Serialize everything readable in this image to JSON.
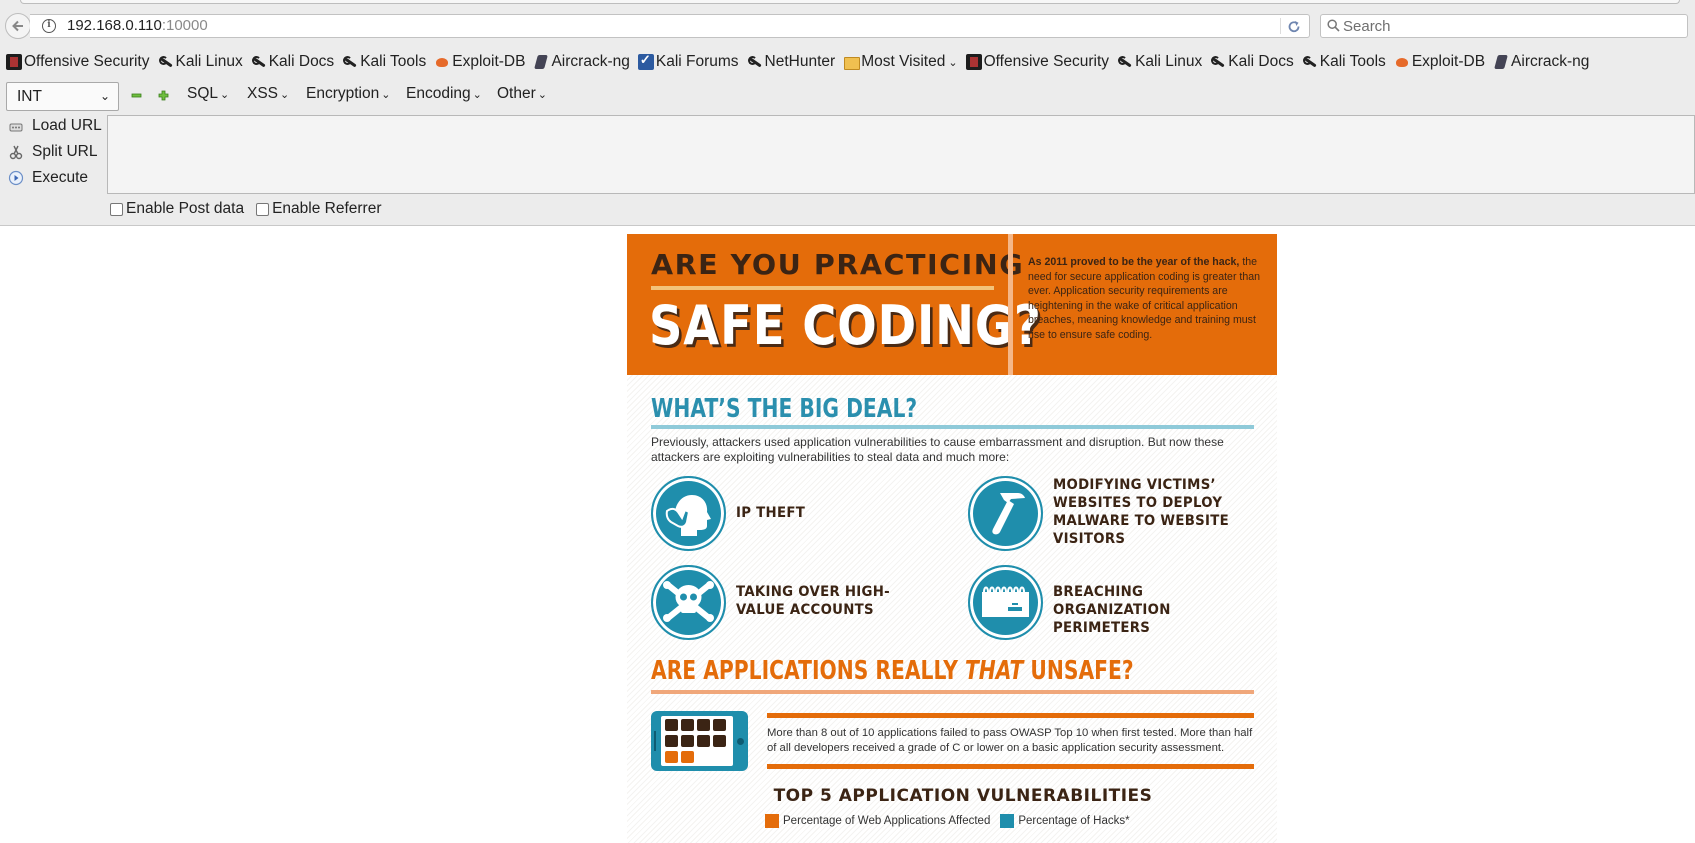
{
  "browser": {
    "url_host": "192.168.0.110",
    "url_port": ":10000",
    "search_placeholder": "Search",
    "bookmarks": [
      {
        "label": "Offensive Security",
        "icon": "offsec-icon"
      },
      {
        "label": "Kali Linux",
        "icon": "kali-icon"
      },
      {
        "label": "Kali Docs",
        "icon": "kali-icon"
      },
      {
        "label": "Kali Tools",
        "icon": "kali-icon"
      },
      {
        "label": "Exploit-DB",
        "icon": "exploit-db-icon"
      },
      {
        "label": "Aircrack-ng",
        "icon": "aircrack-icon"
      },
      {
        "label": "Kali Forums",
        "icon": "forums-icon"
      },
      {
        "label": "NetHunter",
        "icon": "kali-icon"
      },
      {
        "label": "Most Visited",
        "icon": "folder-icon",
        "dropdown": true
      },
      {
        "label": "Offensive Security",
        "icon": "offsec-icon"
      },
      {
        "label": "Kali Linux",
        "icon": "kali-icon"
      },
      {
        "label": "Kali Docs",
        "icon": "kali-icon"
      },
      {
        "label": "Kali Tools",
        "icon": "kali-icon"
      },
      {
        "label": "Exploit-DB",
        "icon": "exploit-db-icon"
      },
      {
        "label": "Aircrack-ng",
        "icon": "aircrack-icon"
      }
    ]
  },
  "hackbar": {
    "select_value": "INT",
    "menus": [
      "SQL",
      "XSS",
      "Encryption",
      "Encoding",
      "Other"
    ],
    "load_url": "Load URL",
    "split_url": "Split URL",
    "execute": "Execute",
    "url_value": "",
    "enable_post": "Enable Post data",
    "enable_referrer": "Enable Referrer"
  },
  "infographic": {
    "hero_line1": "ARE YOU PRACTICING",
    "hero_line2": "SAFE CODING?",
    "hero_blurb_bold": "As 2011 proved to be the year of the hack,",
    "hero_blurb_rest": " the need for secure application coding is greater than ever. Application security requirements are heightening in the wake of critical application breaches, meaning knowledge and training must rise to ensure safe coding.",
    "bigdeal_title": "WHAT’S THE BIG DEAL?",
    "bigdeal_text": "Previously, attackers used application vulnerabilities to cause embarrassment and disruption. But now these attackers are exploiting vulnerabilities to steal data and much more:",
    "threats": [
      "IP THEFT",
      "MODIFYING VICTIMS’ WEBSITES TO DEPLOY MALWARE TO WEBSITE VISITORS",
      "TAKING OVER HIGH-VALUE ACCOUNTS",
      "BREACHING ORGANIZATION PERIMETERS"
    ],
    "unsafe_title_a": "ARE APPLICATIONS REALLY ",
    "unsafe_title_b": "THAT",
    "unsafe_title_c": " UNSAFE?",
    "stat_text": "More than 8 out of 10 applications failed to pass OWASP Top 10 when first tested. More than half of all developers received a grade of C or lower on a basic application security assessment.",
    "top5_title": "TOP 5 APPLICATION VULNERABILITIES",
    "legend_a": "Percentage of Web Applications Affected",
    "legend_b": "Percentage of Hacks*",
    "colors": {
      "orange": "#e46c0a",
      "teal": "#1f8eac",
      "brown": "#3b2414"
    }
  }
}
